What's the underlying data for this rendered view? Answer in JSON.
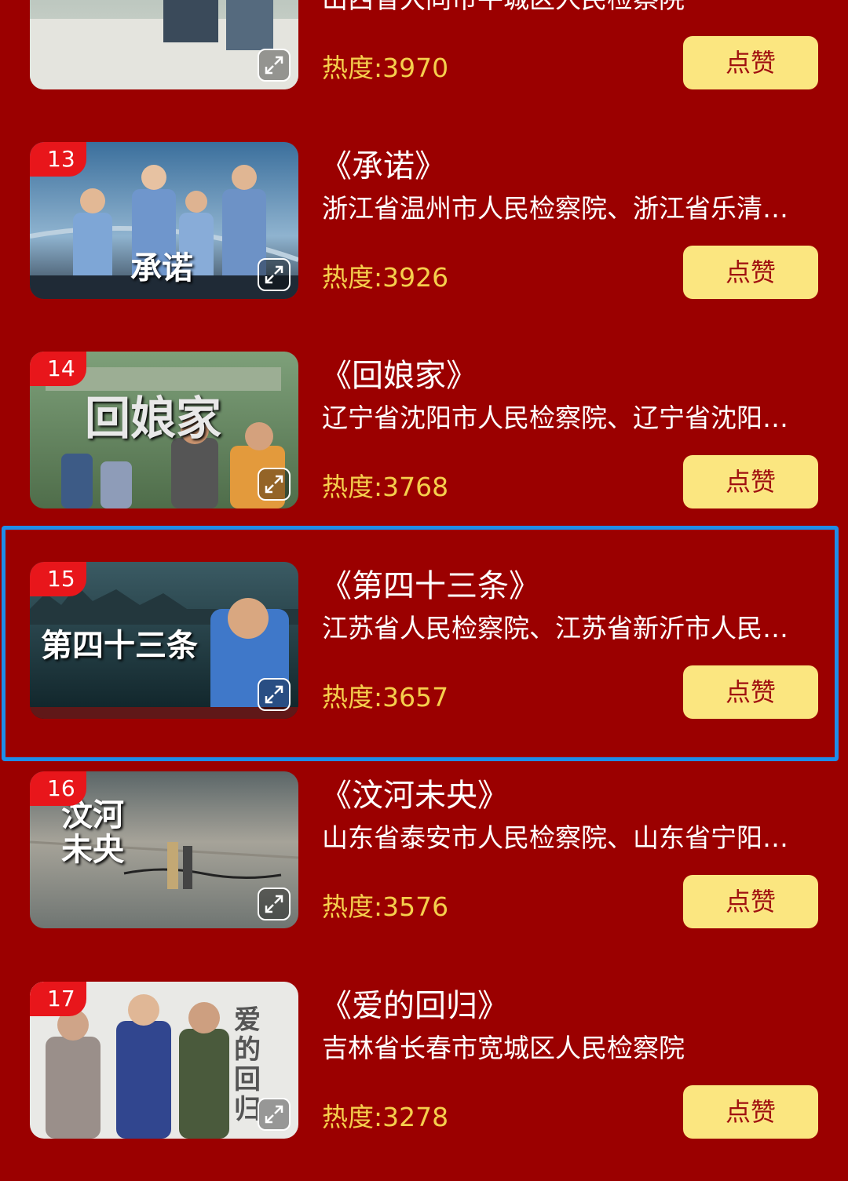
{
  "list": {
    "heat_prefix": "热度:",
    "like_label": "点赞",
    "items": [
      {
        "rank": "",
        "title": "",
        "org": "山西省大同市平城区人民检察院",
        "heat": "3970",
        "poster_text": ""
      },
      {
        "rank": "13",
        "title": "《承诺》",
        "org": "浙江省温州市人民检察院、浙江省乐清市人民检察院",
        "heat": "3926",
        "poster_text": "承诺"
      },
      {
        "rank": "14",
        "title": "《回娘家》",
        "org": "辽宁省沈阳市人民检察院、辽宁省沈阳市人民检察院",
        "heat": "3768",
        "poster_text": "回娘家"
      },
      {
        "rank": "15",
        "title": "《第四十三条》",
        "org": "江苏省人民检察院、江苏省新沂市人民检察院",
        "heat": "3657",
        "poster_text": "第四十三条"
      },
      {
        "rank": "16",
        "title": "《汶河未央》",
        "org": "山东省泰安市人民检察院、山东省宁阳县人民检察院",
        "heat": "3576",
        "poster_text": "汶河未央"
      },
      {
        "rank": "17",
        "title": "《爱的回归》",
        "org": "吉林省长春市宽城区人民检察院",
        "heat": "3278",
        "poster_text": "爱的回归"
      }
    ]
  },
  "colors": {
    "background": "#9b0000",
    "rank_badge": "#e8161b",
    "heat_text": "#f5cf4d",
    "like_button": "#fbe680",
    "selection_border": "#1f8de8"
  },
  "icons": {
    "expand": "expand-icon"
  }
}
